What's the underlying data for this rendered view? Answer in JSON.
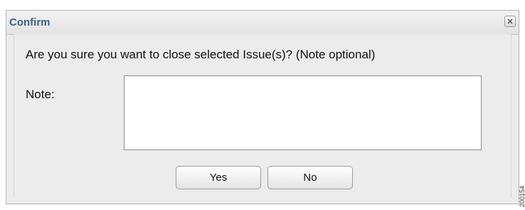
{
  "dialog": {
    "title": "Confirm",
    "close_icon": "close-x-icon",
    "question": "Are you sure you want to close selected Issue(s)? (Note optional)",
    "note_label": "Note:",
    "note_value": "",
    "yes_label": "Yes",
    "no_label": "No"
  },
  "figure_id": "200154",
  "colors": {
    "title_text": "#3b5f8a",
    "dialog_background": "#ececec",
    "field_background": "#ffffff"
  }
}
